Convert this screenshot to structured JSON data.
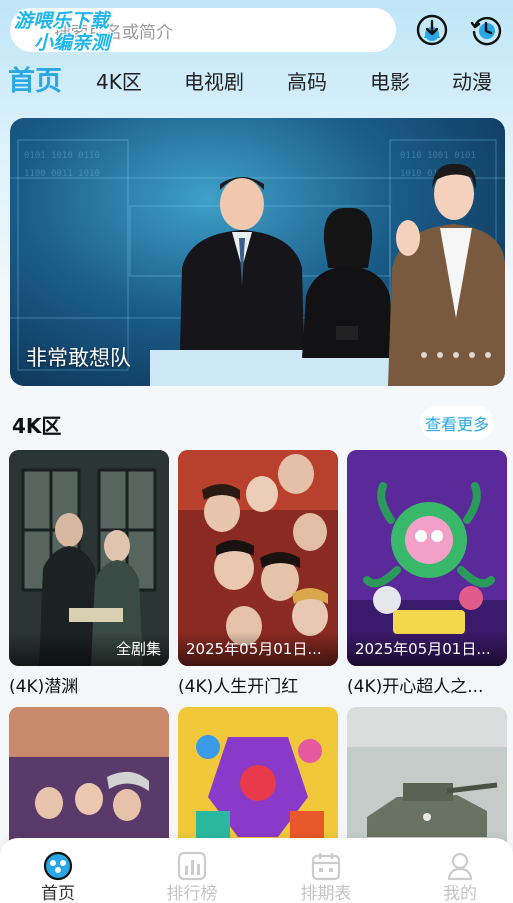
{
  "header": {
    "search_placeholder": "搜索片名或简介",
    "watermark_line1": "游喂乐下载",
    "watermark_line2": "小编亲测",
    "download_icon": "download-icon",
    "history_icon": "history-icon"
  },
  "tabs": [
    {
      "label": "首页",
      "active": true
    },
    {
      "label": "4K区"
    },
    {
      "label": "电视剧"
    },
    {
      "label": "高码"
    },
    {
      "label": "电影"
    },
    {
      "label": "动漫"
    }
  ],
  "banner": {
    "title": "非常敢想队",
    "dot_count": 5
  },
  "section": {
    "title": "4K区",
    "more_label": "查看更多"
  },
  "cards": [
    {
      "title": "(4K)潜渊",
      "caption": "全剧集",
      "colors": [
        "#3d4a48",
        "#1a2022"
      ]
    },
    {
      "title": "(4K)人生开门红",
      "caption": "2025年05月01日...",
      "colors": [
        "#b8462a",
        "#4a1a1c"
      ]
    },
    {
      "title": "(4K)开心超人之...",
      "caption": "2025年05月01日...",
      "colors": [
        "#7a3ab8",
        "#2a1056"
      ]
    },
    {
      "title": "",
      "caption": "",
      "colors": [
        "#6a4a7a",
        "#d88a5a"
      ]
    },
    {
      "title": "",
      "caption": "",
      "colors": [
        "#e8c030",
        "#6a2aa0"
      ]
    },
    {
      "title": "",
      "caption": "",
      "colors": [
        "#b8c2c0",
        "#5a6258"
      ]
    }
  ],
  "bottom_nav": [
    {
      "label": "首页",
      "icon": "home-icon",
      "active": true
    },
    {
      "label": "排行榜",
      "icon": "ranking-icon"
    },
    {
      "label": "排期表",
      "icon": "schedule-icon"
    },
    {
      "label": "我的",
      "icon": "profile-icon"
    }
  ],
  "accent_color": "#2aa8e5"
}
